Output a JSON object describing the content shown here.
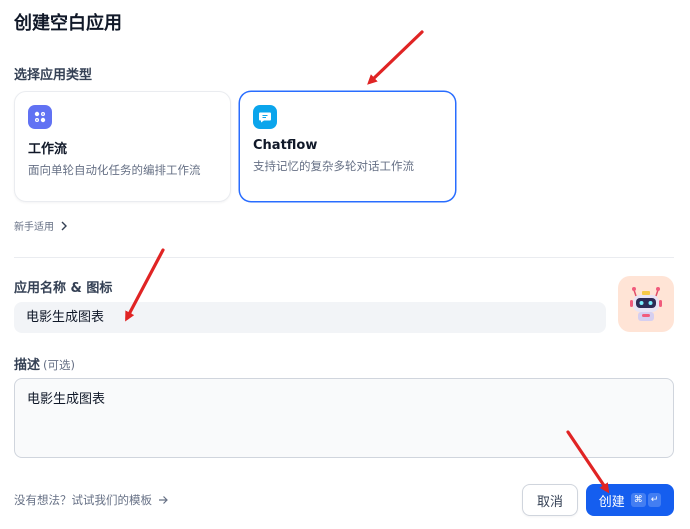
{
  "dialog": {
    "title": "创建空白应用",
    "app_type_label": "选择应用类型",
    "app_types": [
      {
        "name": "工作流",
        "description": "面向单轮自动化任务的编排工作流",
        "icon": "workflow-icon",
        "selected": false
      },
      {
        "name": "Chatflow",
        "description": "支持记忆的复杂多轮对话工作流",
        "icon": "chat-bubble-icon",
        "selected": true
      }
    ],
    "beginner_link": "新手适用",
    "name_label": "应用名称 & 图标",
    "name_value": "电影生成图表",
    "avatar_icon": "robot-icon",
    "desc_label": "描述",
    "desc_optional": "(可选)",
    "desc_value": "电影生成图表",
    "template_link": "没有想法？试试我们的模板",
    "cancel_label": "取消",
    "create_label": "创建",
    "shortcut_keys": [
      "⌘",
      "↵"
    ]
  },
  "colors": {
    "accent": "#155eef",
    "selected_border": "#296dff",
    "annotation_arrow": "#e02424"
  }
}
